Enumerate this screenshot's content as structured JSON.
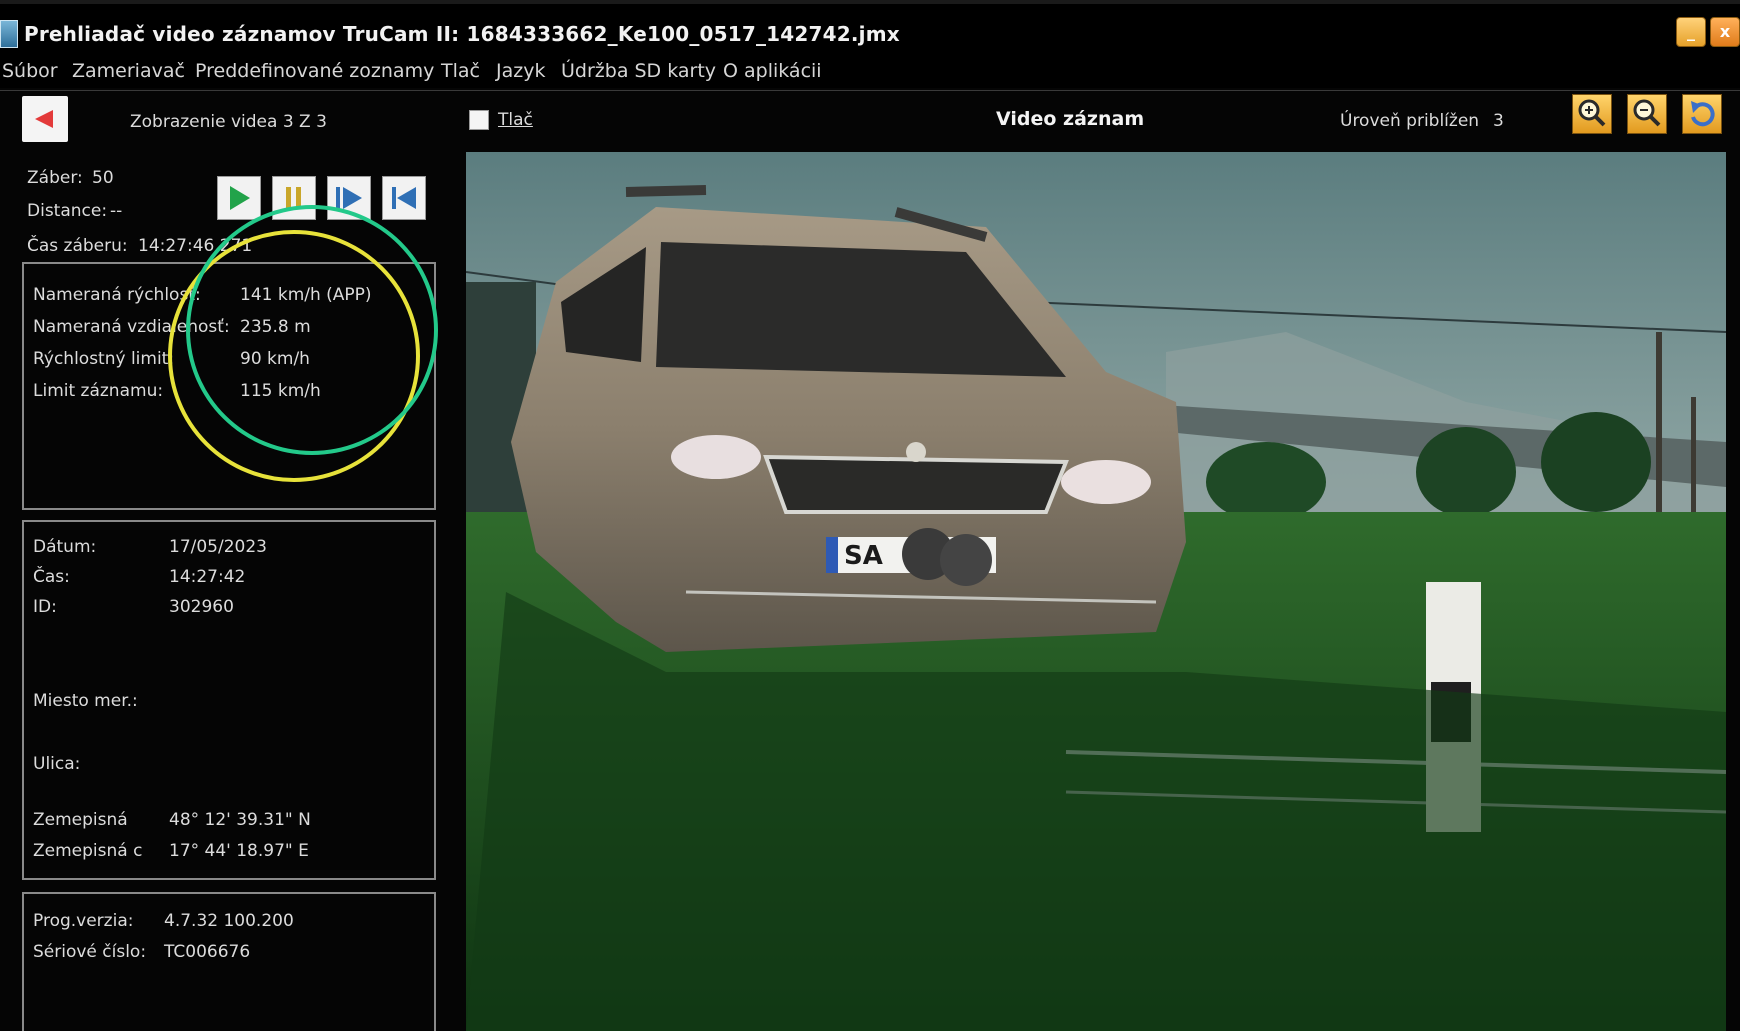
{
  "window": {
    "title": "Prehliadač video záznamov TruCam II:  1684333662_Ke100_0517_142742.jmx",
    "minimize_label": "_",
    "close_label": "x"
  },
  "menu": {
    "items": [
      "Súbor",
      "Zameriavač",
      "Preddefinované zoznamy",
      "Tlač",
      "Jazyk",
      "Údržba SD karty",
      "O aplikácii"
    ]
  },
  "header": {
    "video_view_label": "Zobrazenie videa 3 Z 3",
    "print_label": "Tlač",
    "video_title": "Video záznam",
    "zoom_label": "Úroveň priblížen",
    "zoom_level": "3"
  },
  "frame_info": {
    "frame_label": "Záber:",
    "frame_value": "50",
    "distance_label": "Distance:",
    "distance_value": "--",
    "frame_time_label": "Čas záberu:",
    "frame_time_value": "14:27:46,271"
  },
  "measurement": {
    "rows": [
      {
        "label": "Nameraná rýchlosť:",
        "value": "141 km/h (APP)"
      },
      {
        "label": "Nameraná vzdialenosť:",
        "value": "235.8 m"
      },
      {
        "label": "Rýchlostný limit:",
        "value": "90 km/h"
      },
      {
        "label": "Limit záznamu:",
        "value": "115 km/h"
      }
    ]
  },
  "record": {
    "date_label": "Dátum:",
    "date_value": "17/05/2023",
    "time_label": "Čas:",
    "time_value": "14:27:42",
    "id_label": "ID:",
    "id_value": "302960",
    "place_label": "Miesto mer.:",
    "street_label": "Ulica:",
    "lat_label": "Zemepisná",
    "lat_value": "48° 12' 39.31\" N",
    "lon_label": "Zemepisná c",
    "lon_value": "17° 44' 18.97\" E"
  },
  "device": {
    "version_label": "Prog.verzia:",
    "version_value": "4.7.32  100.200",
    "serial_label": "Sériové číslo:",
    "serial_value": "TC006676"
  },
  "video": {
    "plate_visible": "SA"
  },
  "colors": {
    "green_circle": "#23c98a",
    "yellow_circle": "#e7e23a"
  }
}
